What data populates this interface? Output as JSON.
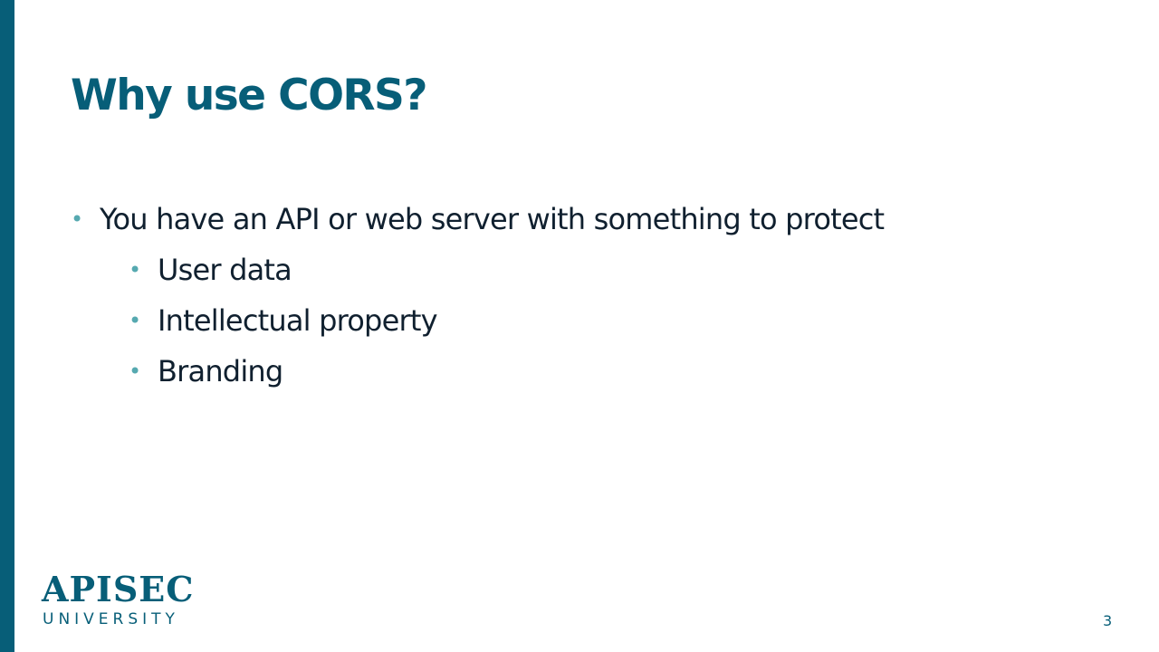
{
  "slide": {
    "title": "Why use CORS?",
    "bullets": [
      {
        "text": "You have an API or web server with something to protect",
        "sub_bullets": [
          "User data",
          "Intellectual property",
          "Branding"
        ]
      }
    ],
    "bullet_glyph": "•",
    "page_number": "3"
  },
  "logo": {
    "main_text": "APISEC",
    "sub_text": "UNIVERSITY"
  },
  "colors": {
    "accent_bar": "#075e78",
    "title": "#075e78",
    "bullet": "#56a9b0",
    "body_text": "#10202f"
  }
}
